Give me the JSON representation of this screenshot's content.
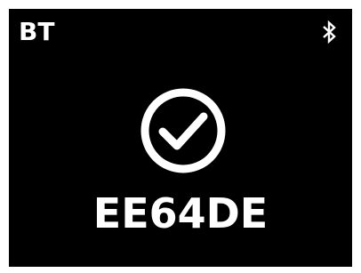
{
  "status_bar": {
    "mode_label": "BT",
    "connection_icon": "bluetooth-icon"
  },
  "main": {
    "status_icon": "check-circle-icon",
    "device_id": "EE64DE"
  },
  "colors": {
    "background": "#000000",
    "foreground": "#ffffff",
    "frame": "#ffffff"
  }
}
